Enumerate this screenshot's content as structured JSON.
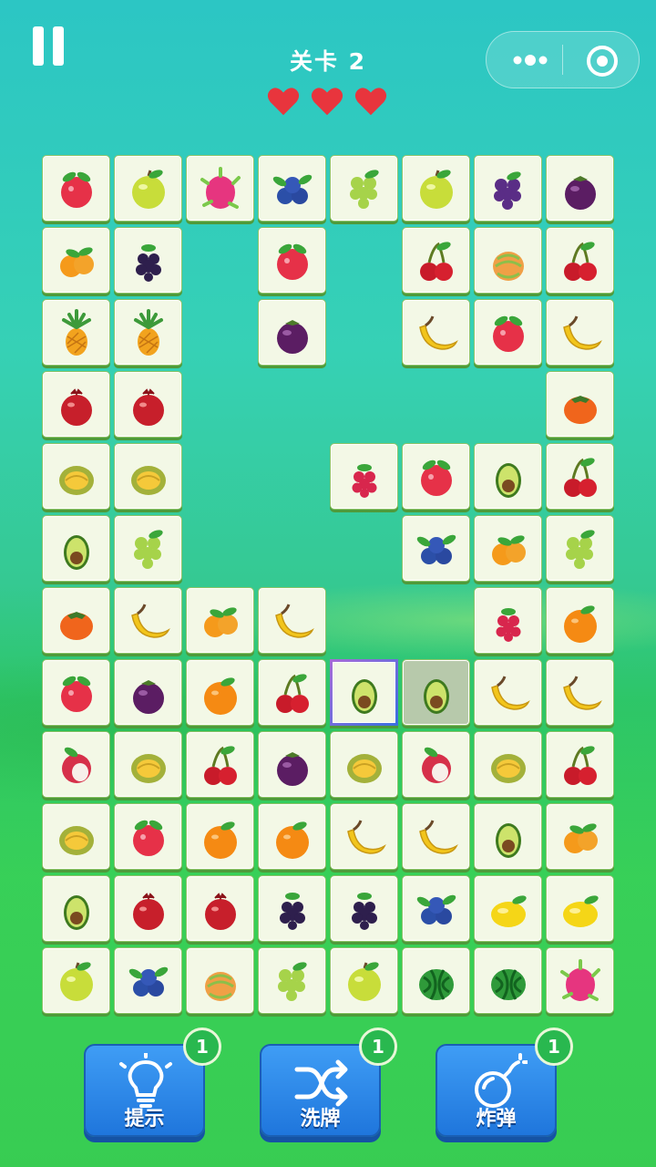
{
  "header": {
    "level_label": "关卡 2",
    "hearts": 3,
    "heart_color": "#e8353d"
  },
  "capsule": {
    "more_icon": "more-dots-icon",
    "close_icon": "target-circle-icon"
  },
  "board": {
    "cols": 8,
    "rows": 12,
    "selected": [
      7,
      4
    ],
    "dimmed": [
      7,
      5
    ],
    "grid": [
      [
        "apple_red",
        "apple_green",
        "dragonfruit",
        "blueberry",
        "grape_green",
        "apple_green",
        "grape_purple",
        "mangosteen"
      ],
      [
        "orange_small",
        "blackberry",
        null,
        "apple_red",
        null,
        "cherry",
        "melon",
        "cherry"
      ],
      [
        "pineapple",
        "pineapple",
        null,
        "mangosteen",
        null,
        "banana",
        "apple_red",
        "banana"
      ],
      [
        "pomegranate",
        "pomegranate",
        null,
        null,
        null,
        null,
        null,
        "persimmon"
      ],
      [
        "durian",
        "durian",
        null,
        null,
        "raspberry",
        "apple_red",
        "avocado",
        "cherry"
      ],
      [
        "avocado",
        "grape_green",
        null,
        null,
        null,
        "blueberry",
        "orange_small",
        "grape_green"
      ],
      [
        "persimmon",
        "banana",
        "orange_small",
        "banana",
        null,
        null,
        "raspberry",
        "orange"
      ],
      [
        "apple_red",
        "mangosteen",
        "orange",
        "cherry",
        "avocado",
        "avocado",
        "banana",
        "banana"
      ],
      [
        "lychee",
        "durian",
        "cherry",
        "mangosteen",
        "durian",
        "lychee",
        "durian",
        "cherry"
      ],
      [
        "durian",
        "apple_red",
        "orange",
        "orange",
        "banana",
        "banana",
        "avocado",
        "orange_small"
      ],
      [
        "avocado",
        "pomegranate",
        "pomegranate",
        "blackberry",
        "blackberry",
        "blueberry",
        "lemon",
        "lemon"
      ],
      [
        "apple_green",
        "blueberry",
        "melon",
        "grape_green",
        "apple_green",
        "watermelon",
        "watermelon",
        "dragonfruit"
      ]
    ]
  },
  "toolbar": {
    "hint": {
      "label": "提示",
      "count": "1",
      "icon": "lightbulb-icon"
    },
    "shuffle": {
      "label": "洗牌",
      "count": "1",
      "icon": "shuffle-icon"
    },
    "bomb": {
      "label": "炸弹",
      "count": "1",
      "icon": "bomb-icon"
    }
  }
}
